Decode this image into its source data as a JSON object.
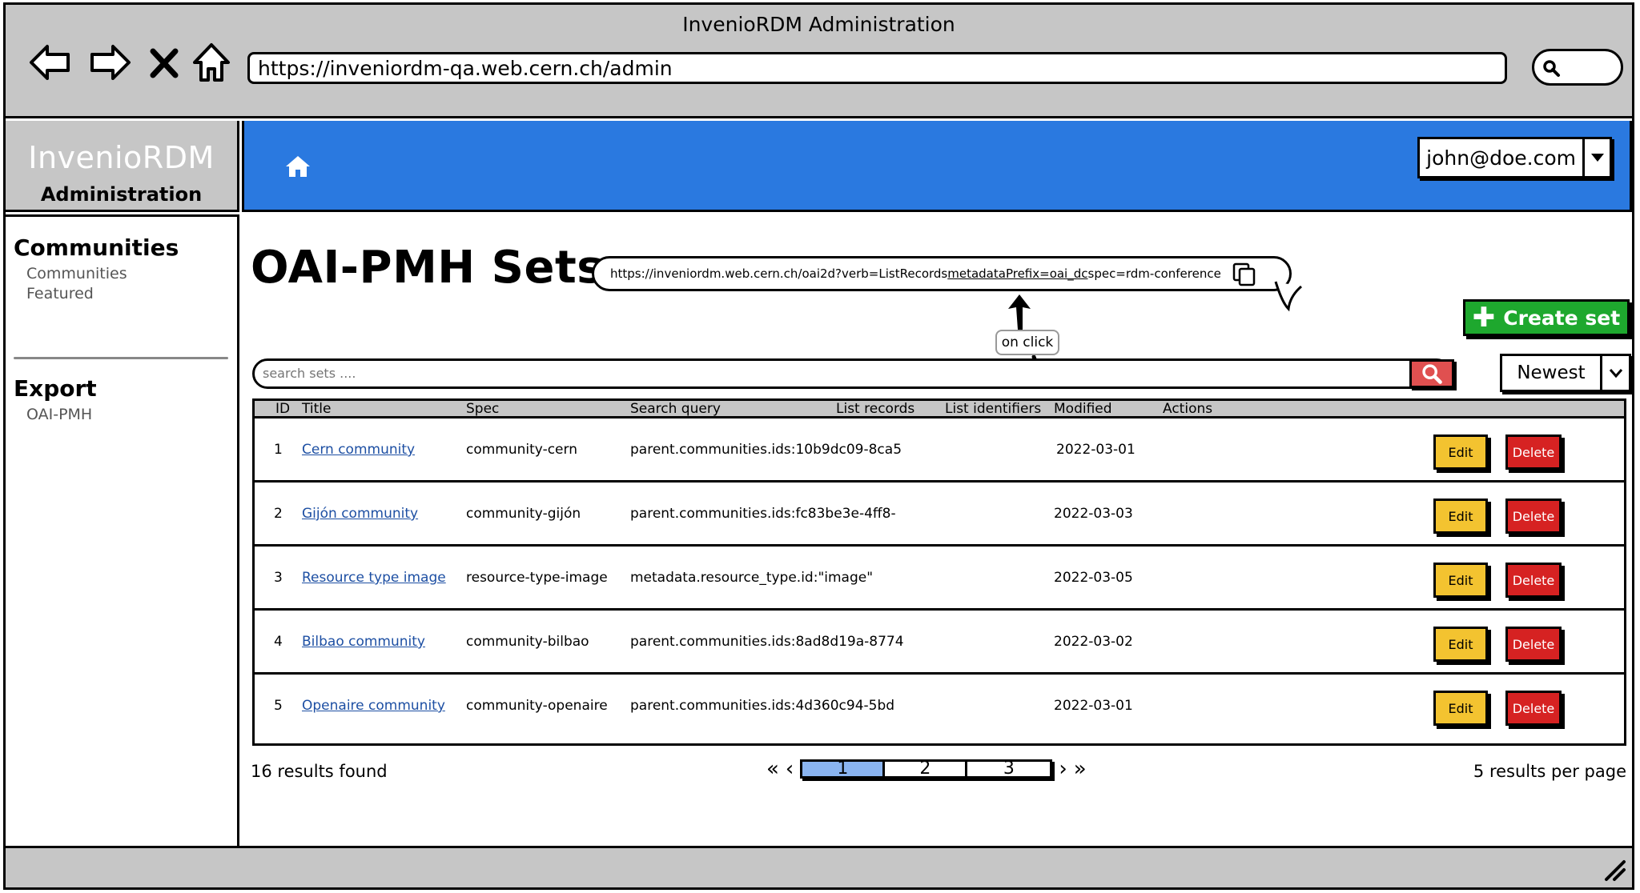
{
  "browser": {
    "title": "InvenioRDM Administration",
    "url": "https://inveniordm-qa.web.cern.ch/admin"
  },
  "brand": {
    "title": "InvenioRDM",
    "subtitle": "Administration"
  },
  "topbar": {
    "user_email": "john@doe.com"
  },
  "sidebar": {
    "sections": [
      {
        "heading": "Communities",
        "items": [
          "Communities",
          "Featured"
        ]
      },
      {
        "heading": "Export",
        "items": [
          "OAI-PMH"
        ]
      }
    ]
  },
  "main": {
    "title": "OAI-PMH Sets",
    "oai_url": {
      "prefix": "https://inveniordm.web.cern.ch/oai2d?verb=ListRecords",
      "underlined": "metadataPrefix=oai_dc",
      "suffix": "spec=rdm-conference"
    },
    "annotation": "on click",
    "create_button": "Create set",
    "search_placeholder": "search sets ....",
    "sort": "Newest",
    "table": {
      "headers": [
        "ID",
        "Title",
        "Spec",
        "Search query",
        "List records",
        "List identifiers",
        "Modified",
        "Actions"
      ],
      "rows": [
        {
          "id": "1",
          "title": "Cern community",
          "spec": "community-cern",
          "query": "parent.communities.ids:10b9dc09-8ca5",
          "modified": "2022-03-01"
        },
        {
          "id": "2",
          "title": "Gijón community",
          "spec": "community-gijón",
          "query": "parent.communities.ids:fc83be3e-4ff8-",
          "modified": "2022-03-03"
        },
        {
          "id": "3",
          "title": "Resource type image",
          "spec": "resource-type-image",
          "query": "metadata.resource_type.id:\"image\"",
          "modified": "2022-03-05"
        },
        {
          "id": "4",
          "title": "Bilbao community",
          "spec": "community-bilbao",
          "query": "parent.communities.ids:8ad8d19a-8774",
          "modified": "2022-03-02"
        },
        {
          "id": "5",
          "title": "Openaire community",
          "spec": "community-openaire",
          "query": "parent.communities.ids:4d360c94-5bd",
          "modified": "2022-03-01"
        }
      ],
      "edit_label": "Edit",
      "delete_label": "Delete"
    },
    "results_found": "16 results found",
    "pagination": {
      "pages": [
        "1",
        "2",
        "3"
      ],
      "active": "1",
      "first": "«",
      "prev": "‹",
      "next": "›",
      "last": "»"
    },
    "per_page": "5 results per page"
  },
  "colors": {
    "topbar": "#2a79e0",
    "create": "#1ea82e",
    "edit": "#f3c330",
    "delete": "#d62222",
    "chrome": "#c6c6c6"
  },
  "icons": [
    "back-icon",
    "forward-icon",
    "close-icon",
    "home-icon",
    "search-icon",
    "copy-icon",
    "chevron-down-icon",
    "plus-icon"
  ]
}
